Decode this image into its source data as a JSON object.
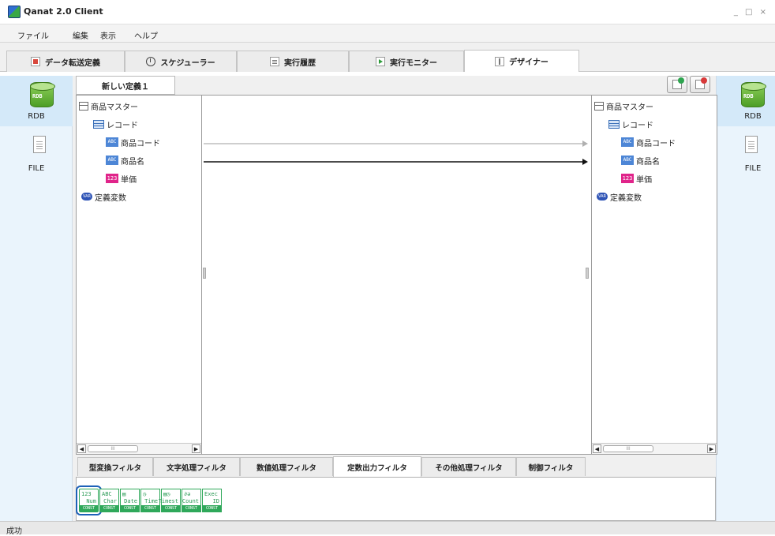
{
  "window": {
    "title": "Qanat 2.0 Client",
    "controls": "_ □ ×"
  },
  "menu": [
    "ファイル",
    "編集",
    "表示",
    "ヘルプ"
  ],
  "main_tabs": [
    {
      "label": "データ転送定義",
      "icon": "transfer-def-icon"
    },
    {
      "label": "スケジューラー",
      "icon": "clock-icon"
    },
    {
      "label": "実行履歴",
      "icon": "history-icon"
    },
    {
      "label": "実行モニター",
      "icon": "monitor-icon"
    },
    {
      "label": "デザイナー",
      "icon": "designer-icon",
      "active": true
    }
  ],
  "side_left": {
    "rdb_label": "RDB",
    "file_label": "FILE",
    "rdb_icon_text": "RDB"
  },
  "side_right": {
    "rdb_label": "RDB",
    "file_label": "FILE",
    "rdb_icon_text": "RDB"
  },
  "definition_tab": "新しい定義１",
  "icon_text": {
    "abc": "ABC",
    "num": "123",
    "var": "VAR"
  },
  "tree_left": {
    "table": "商品マスター",
    "record": "レコード",
    "fields": [
      {
        "type": "string",
        "name": "商品コード"
      },
      {
        "type": "string",
        "name": "商品名"
      },
      {
        "type": "number",
        "name": "単価"
      }
    ],
    "constants": "定義変数"
  },
  "tree_right": {
    "table": "商品マスター",
    "record": "レコード",
    "fields": [
      {
        "type": "string",
        "name": "商品コード"
      },
      {
        "type": "string",
        "name": "商品名"
      },
      {
        "type": "number",
        "name": "単価"
      }
    ],
    "constants": "定義変数"
  },
  "mappings": [
    {
      "from": "商品コード",
      "to": "商品コード",
      "state": "inactive",
      "color": "#b0b0b0"
    },
    {
      "from": "商品名",
      "to": "商品名",
      "state": "active",
      "color": "#111111"
    }
  ],
  "filter_tabs": [
    {
      "label": "型変換フィルタ"
    },
    {
      "label": "文字処理フィルタ"
    },
    {
      "label": "数値処理フィルタ"
    },
    {
      "label": "定数出力フィルタ",
      "active": true
    },
    {
      "label": "その他処理フィルタ"
    },
    {
      "label": "制御フィルタ"
    }
  ],
  "palette": [
    {
      "top": "123",
      "name": "Num",
      "const": "CONST",
      "selected": true
    },
    {
      "top": "ABC",
      "name": "Char",
      "const": "CONST"
    },
    {
      "top": "▤",
      "name": "Date",
      "const": "CONST"
    },
    {
      "top": "◷",
      "name": "Time",
      "const": "CONST"
    },
    {
      "top": "▤◷",
      "name": "Timest",
      "const": "CONST"
    },
    {
      "top": "∂ə",
      "name": "Count",
      "const": "CONST"
    },
    {
      "top": "Exec",
      "name": "ID",
      "const": "CONST"
    }
  ],
  "status": "成功",
  "colors": {
    "side_panel": "#eaf4fc",
    "selected_outline": "#1e61b8",
    "palette_green": "#2fa85a"
  }
}
